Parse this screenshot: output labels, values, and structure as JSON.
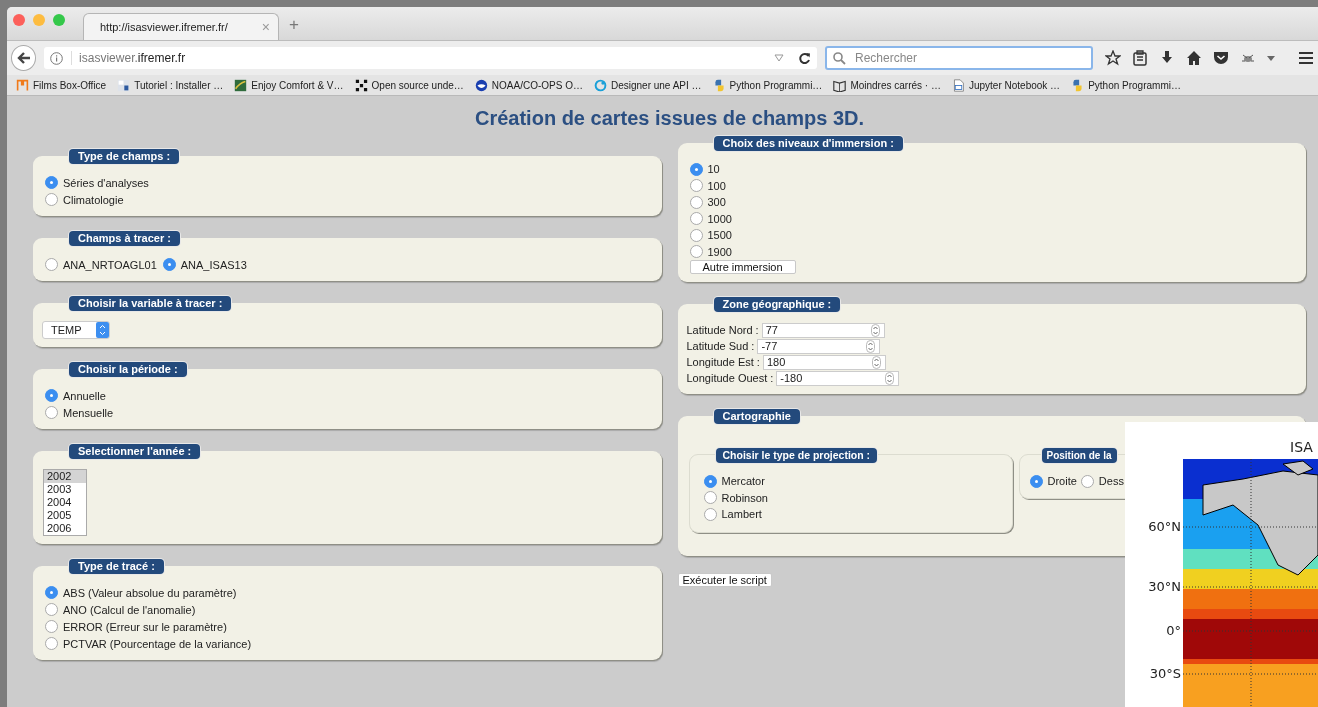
{
  "browser": {
    "tab": {
      "title": "http://isasviewer.ifremer.fr/",
      "close": "×"
    },
    "new_tab": "+",
    "url": {
      "host": "isasviewer.",
      "domain": "ifremer.fr"
    },
    "search": {
      "placeholder": "Rechercher"
    },
    "bookmarks": [
      {
        "label": "Films Box-Office"
      },
      {
        "label": "Tutoriel : Installer …"
      },
      {
        "label": "Enjoy Comfort & V…"
      },
      {
        "label": "Open source unde…"
      },
      {
        "label": "NOAA/CO-OPS O…"
      },
      {
        "label": "Designer une API …"
      },
      {
        "label": "Python Programmi…"
      },
      {
        "label": "Moindres carrés · …"
      },
      {
        "label": "Jupyter Notebook …"
      },
      {
        "label": "Python Programmi…"
      }
    ]
  },
  "page": {
    "title": "Création de cartes issues de champs 3D.",
    "left": [
      {
        "kind": "radios",
        "legend": "Type de champs :",
        "options": [
          {
            "label": "Séries d'analyses",
            "selected": true
          },
          {
            "label": "Climatologie",
            "selected": false
          }
        ]
      },
      {
        "kind": "radios",
        "inline": true,
        "legend": "Champs à tracer :",
        "options": [
          {
            "label": "ANA_NRTOAGL01",
            "selected": false
          },
          {
            "label": "ANA_ISAS13",
            "selected": true
          }
        ]
      },
      {
        "kind": "select",
        "legend": "Choisir la variable à tracer :",
        "value": "TEMP"
      },
      {
        "kind": "radios",
        "legend": "Choisir la période :",
        "options": [
          {
            "label": "Annuelle",
            "selected": true
          },
          {
            "label": "Mensuelle",
            "selected": false
          }
        ]
      },
      {
        "kind": "listbox",
        "legend": "Selectionner l'année :",
        "items": [
          {
            "label": "2002",
            "selected": true
          },
          {
            "label": "2003",
            "selected": false
          },
          {
            "label": "2004",
            "selected": false
          },
          {
            "label": "2005",
            "selected": false
          },
          {
            "label": "2006",
            "selected": false
          }
        ]
      },
      {
        "kind": "radios",
        "legend": "Type de tracé :",
        "options": [
          {
            "label": "ABS (Valeur absolue du paramètre)",
            "selected": true
          },
          {
            "label": "ANO (Calcul de l'anomalie)",
            "selected": false
          },
          {
            "label": "ERROR (Erreur sur le paramètre)",
            "selected": false
          },
          {
            "label": "PCTVAR (Pourcentage de la variance)",
            "selected": false
          }
        ]
      }
    ],
    "right": [
      {
        "kind": "radios",
        "legend": "Choix des niveaux d'immersion :",
        "options": [
          {
            "label": "10",
            "selected": true
          },
          {
            "label": "100",
            "selected": false
          },
          {
            "label": "300",
            "selected": false
          },
          {
            "label": "1000",
            "selected": false
          },
          {
            "label": "1500",
            "selected": false
          },
          {
            "label": "1900",
            "selected": false
          }
        ],
        "button": "Autre immersion"
      },
      {
        "kind": "numbers",
        "legend": "Zone géographique :",
        "fields": [
          {
            "label": "Latitude Nord :",
            "value": "77"
          },
          {
            "label": "Latitude Sud :",
            "value": "-77"
          },
          {
            "label": "Longitude Est :",
            "value": "180"
          },
          {
            "label": "Longitude Ouest :",
            "value": "-180"
          }
        ]
      },
      {
        "kind": "group",
        "legend": "Cartographie",
        "children": [
          {
            "kind": "radios",
            "legend": "Choisir le type de projection :",
            "options": [
              {
                "label": "Mercator",
                "selected": true
              },
              {
                "label": "Robinson",
                "selected": false
              },
              {
                "label": "Lambert",
                "selected": false
              }
            ]
          },
          {
            "kind": "radios",
            "inline": true,
            "legend": "Position de la",
            "options": [
              {
                "label": "Droite",
                "selected": true
              },
              {
                "label": "Dess",
                "selected": false
              }
            ]
          }
        ]
      }
    ],
    "run_button": "Exécuter le script"
  },
  "figure": {
    "title": "ISA",
    "lat_labels": [
      "60°N",
      "30°N",
      "0°",
      "30°S"
    ]
  }
}
